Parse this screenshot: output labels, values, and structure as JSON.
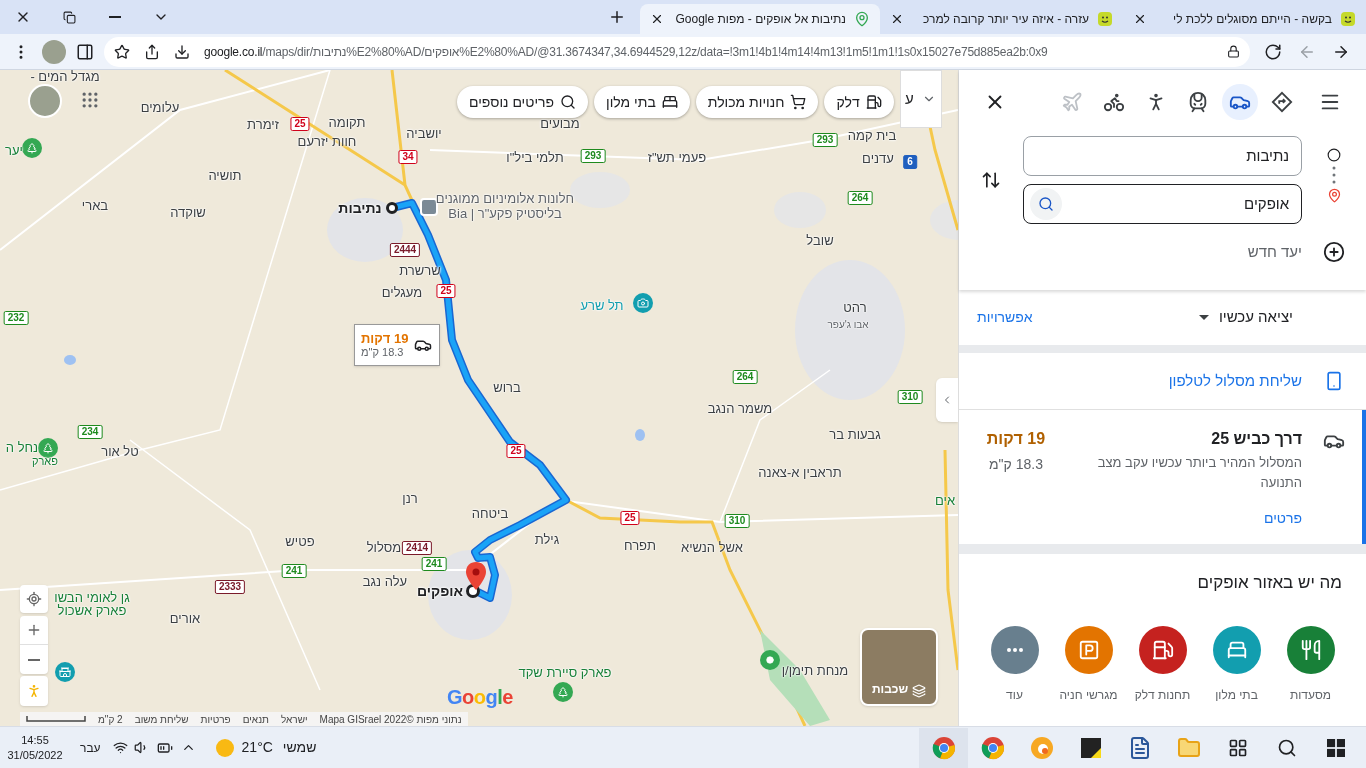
{
  "browser": {
    "tabs": [
      {
        "title": "בקשה - הייתם מסוגלים ללכת לי",
        "kind": "forum",
        "selected": false
      },
      {
        "title": "עזרה - איזה עיר יותר קרובה למרכ",
        "kind": "forum",
        "selected": false
      },
      {
        "title": "נתיבות אל אופקים - מפות Google",
        "kind": "maps",
        "selected": true
      }
    ],
    "url_host": "google.co.il",
    "url_path": "/maps/dir/נתיבות%E2%80%AD/אופקים%E2%80%AD/@31.3674347,34.6944529,12z/data=!3m1!4b1!4m14!4m13!1m5!1m1!1s0x15027e75d885ea2b:0x9"
  },
  "map": {
    "chips": [
      {
        "label": "דלק",
        "kind": "fuel"
      },
      {
        "label": "חנויות מכולת",
        "kind": "grocery"
      },
      {
        "label": "בתי מלון",
        "kind": "hotel"
      },
      {
        "label": "פריטים נוספים",
        "kind": "more"
      }
    ],
    "more_tab": "ע",
    "labels": [
      {
        "text": "מגדל המים -",
        "kind": "town"
      },
      {
        "text": "עלומים",
        "kind": "town"
      },
      {
        "text": "תקומה",
        "kind": "town"
      },
      {
        "text": "זימרת",
        "kind": "town"
      },
      {
        "text": "חוות יזרעם",
        "kind": "town"
      },
      {
        "text": "יושביה",
        "kind": "town"
      },
      {
        "text": "מבועים",
        "kind": "town"
      },
      {
        "text": "פעמי תש\"ז",
        "kind": "town"
      },
      {
        "text": "תלמי ביל\"ו",
        "kind": "town"
      },
      {
        "text": "בית קמה",
        "kind": "town"
      },
      {
        "text": "עדנים",
        "kind": "town"
      },
      {
        "text": "תושיה",
        "kind": "town"
      },
      {
        "text": "בארי",
        "kind": "town"
      },
      {
        "text": "שוקדה",
        "kind": "town"
      },
      {
        "text": "נתיבות",
        "kind": "city"
      },
      {
        "text": "חלונות אלומיניום ממוגנים",
        "kind": "poi"
      },
      {
        "text": "בליסטיק פקע\"ר | Bia",
        "kind": "poi"
      },
      {
        "text": "שובל",
        "kind": "town"
      },
      {
        "text": "שרשרת",
        "kind": "town"
      },
      {
        "text": "מעגלים",
        "kind": "town"
      },
      {
        "text": "תל שרע",
        "kind": "site"
      },
      {
        "text": "רהט",
        "kind": "town"
      },
      {
        "text": "אבו ג'עפר",
        "kind": "small"
      },
      {
        "text": "ברוש",
        "kind": "town"
      },
      {
        "text": "משמר הנגב",
        "kind": "town"
      },
      {
        "text": "גבעות בר",
        "kind": "town"
      },
      {
        "text": "נחל ה",
        "kind": "park"
      },
      {
        "text": "פארק",
        "kind": "park-small"
      },
      {
        "text": "טל אור",
        "kind": "town"
      },
      {
        "text": "תראבין א-צאנה",
        "kind": "town"
      },
      {
        "text": "רנן",
        "kind": "town"
      },
      {
        "text": "ביטחה",
        "kind": "town"
      },
      {
        "text": "אים",
        "kind": "park"
      },
      {
        "text": "אשל הנשיא",
        "kind": "town"
      },
      {
        "text": "תפרח",
        "kind": "town"
      },
      {
        "text": "גילת",
        "kind": "town"
      },
      {
        "text": "מסלול",
        "kind": "town"
      },
      {
        "text": "פטיש",
        "kind": "town"
      },
      {
        "text": "עלה נגב",
        "kind": "town"
      },
      {
        "text": "אופקים",
        "kind": "city"
      },
      {
        "text": "גן לאומי הבשו",
        "kind": "park"
      },
      {
        "text": "פארק אשכול",
        "kind": "park"
      },
      {
        "text": "אורים",
        "kind": "town"
      },
      {
        "text": "פארק סיירת שקד",
        "kind": "park"
      },
      {
        "text": "מנחת תימן/ן",
        "kind": "town"
      },
      {
        "text": "יער",
        "kind": "park"
      }
    ],
    "roads": [
      {
        "number": "25",
        "kind": "national"
      },
      {
        "number": "34",
        "kind": "national"
      },
      {
        "number": "293",
        "kind": "regional"
      },
      {
        "number": "293",
        "kind": "regional"
      },
      {
        "number": "6",
        "kind": "toll"
      },
      {
        "number": "264",
        "kind": "regional"
      },
      {
        "number": "2444",
        "kind": "local"
      },
      {
        "number": "25",
        "kind": "national"
      },
      {
        "number": "232",
        "kind": "regional"
      },
      {
        "number": "264",
        "kind": "regional"
      },
      {
        "number": "310",
        "kind": "regional"
      },
      {
        "number": "234",
        "kind": "regional"
      },
      {
        "number": "25",
        "kind": "national"
      },
      {
        "number": "25",
        "kind": "national"
      },
      {
        "number": "310",
        "kind": "regional"
      },
      {
        "number": "2414",
        "kind": "local"
      },
      {
        "number": "241",
        "kind": "regional"
      },
      {
        "number": "241",
        "kind": "regional"
      },
      {
        "number": "2333",
        "kind": "local"
      }
    ],
    "route_popup": {
      "duration": "19 דקות",
      "distance": "18.3 ק\"מ"
    },
    "layers_label": "שכבות",
    "google_logo": "Google",
    "attribution": [
      "נתוני מפות ©2022 Mapa GISrael",
      "ישראל",
      "תנאים",
      "פרטיות",
      "שליחת משוב",
      "2 ק\"מ"
    ]
  },
  "panel": {
    "travel_modes": [
      {
        "kind": "best",
        "selected": false,
        "disabled": false
      },
      {
        "kind": "drive",
        "selected": true,
        "disabled": false
      },
      {
        "kind": "transit",
        "selected": false,
        "disabled": false
      },
      {
        "kind": "walk",
        "selected": false,
        "disabled": false
      },
      {
        "kind": "bike",
        "selected": false,
        "disabled": false
      },
      {
        "kind": "flight",
        "selected": false,
        "disabled": true
      }
    ],
    "origin": "נתיבות",
    "destination": "אופקים",
    "add_destination": "יעד חדש",
    "depart": "יציאה עכשיו",
    "options": "אפשרויות",
    "send_to_phone": "שליחת מסלול לטלפון",
    "routes": [
      {
        "title": "דרך כביש 25",
        "duration": "19 דקות",
        "distance": "18.3 ק\"מ",
        "description": "המסלול המהיר ביותר עכשיו עקב מצב התנועה",
        "details": "פרטים",
        "selected": true
      }
    ],
    "nearby": {
      "title": "מה יש באזור אופקים",
      "items": [
        {
          "label": "מסעדות",
          "kind": "restaurant",
          "color": "#188038"
        },
        {
          "label": "בתי מלון",
          "kind": "hotel",
          "color": "#129eaf"
        },
        {
          "label": "תחנות דלק",
          "kind": "fuel",
          "color": "#c5221f"
        },
        {
          "label": "מגרשי חניה",
          "kind": "parking",
          "color": "#e37400"
        },
        {
          "label": "עוד",
          "kind": "more",
          "color": "#687f8e"
        }
      ]
    }
  },
  "taskbar": {
    "time": "14:55",
    "date": "31/05/2022",
    "language": "עבר",
    "temperature": "21°C",
    "weather": "שמשי",
    "apps": [
      {
        "kind": "browser-photo"
      },
      {
        "kind": "browser"
      },
      {
        "kind": "swirl"
      },
      {
        "kind": "note"
      },
      {
        "kind": "document"
      },
      {
        "kind": "folder"
      },
      {
        "kind": "taskview"
      },
      {
        "kind": "search"
      },
      {
        "kind": "start"
      }
    ]
  }
}
